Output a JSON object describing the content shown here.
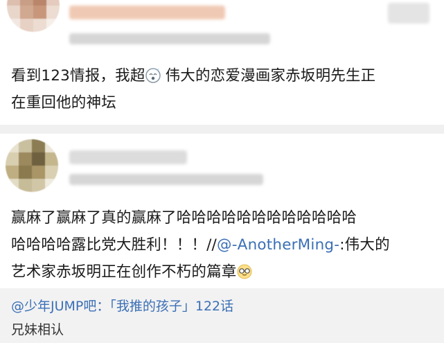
{
  "post1": {
    "avatar": "blurred-avatar",
    "content_pre": "看到123情报，我超",
    "emoji": "dizzy-face-emoji",
    "content_post": " 伟大的恋爱漫画家赤坂明先生正",
    "content_line2": "在重回他的神坛"
  },
  "post2": {
    "avatar": "blurred-avatar",
    "line1": "赢麻了赢麻了真的赢麻了哈哈哈哈哈哈哈哈哈哈哈哈",
    "line2_pre": "哈哈哈哈露比党大胜利！！！//",
    "mention": "@-AnotherMing-",
    "line2_post": ":伟大的",
    "line3": "艺术家赤坂明正在创作不朽的篇章",
    "emoji": "sunglasses-emoji"
  },
  "quote": {
    "source": "@少年JUMP吧：「我推的孩子」122话",
    "title": "兄妹相认"
  },
  "colors": {
    "link": "#3b6fb6",
    "divider": "#f0f0f0",
    "quote_bg": "#f2f2f2"
  }
}
